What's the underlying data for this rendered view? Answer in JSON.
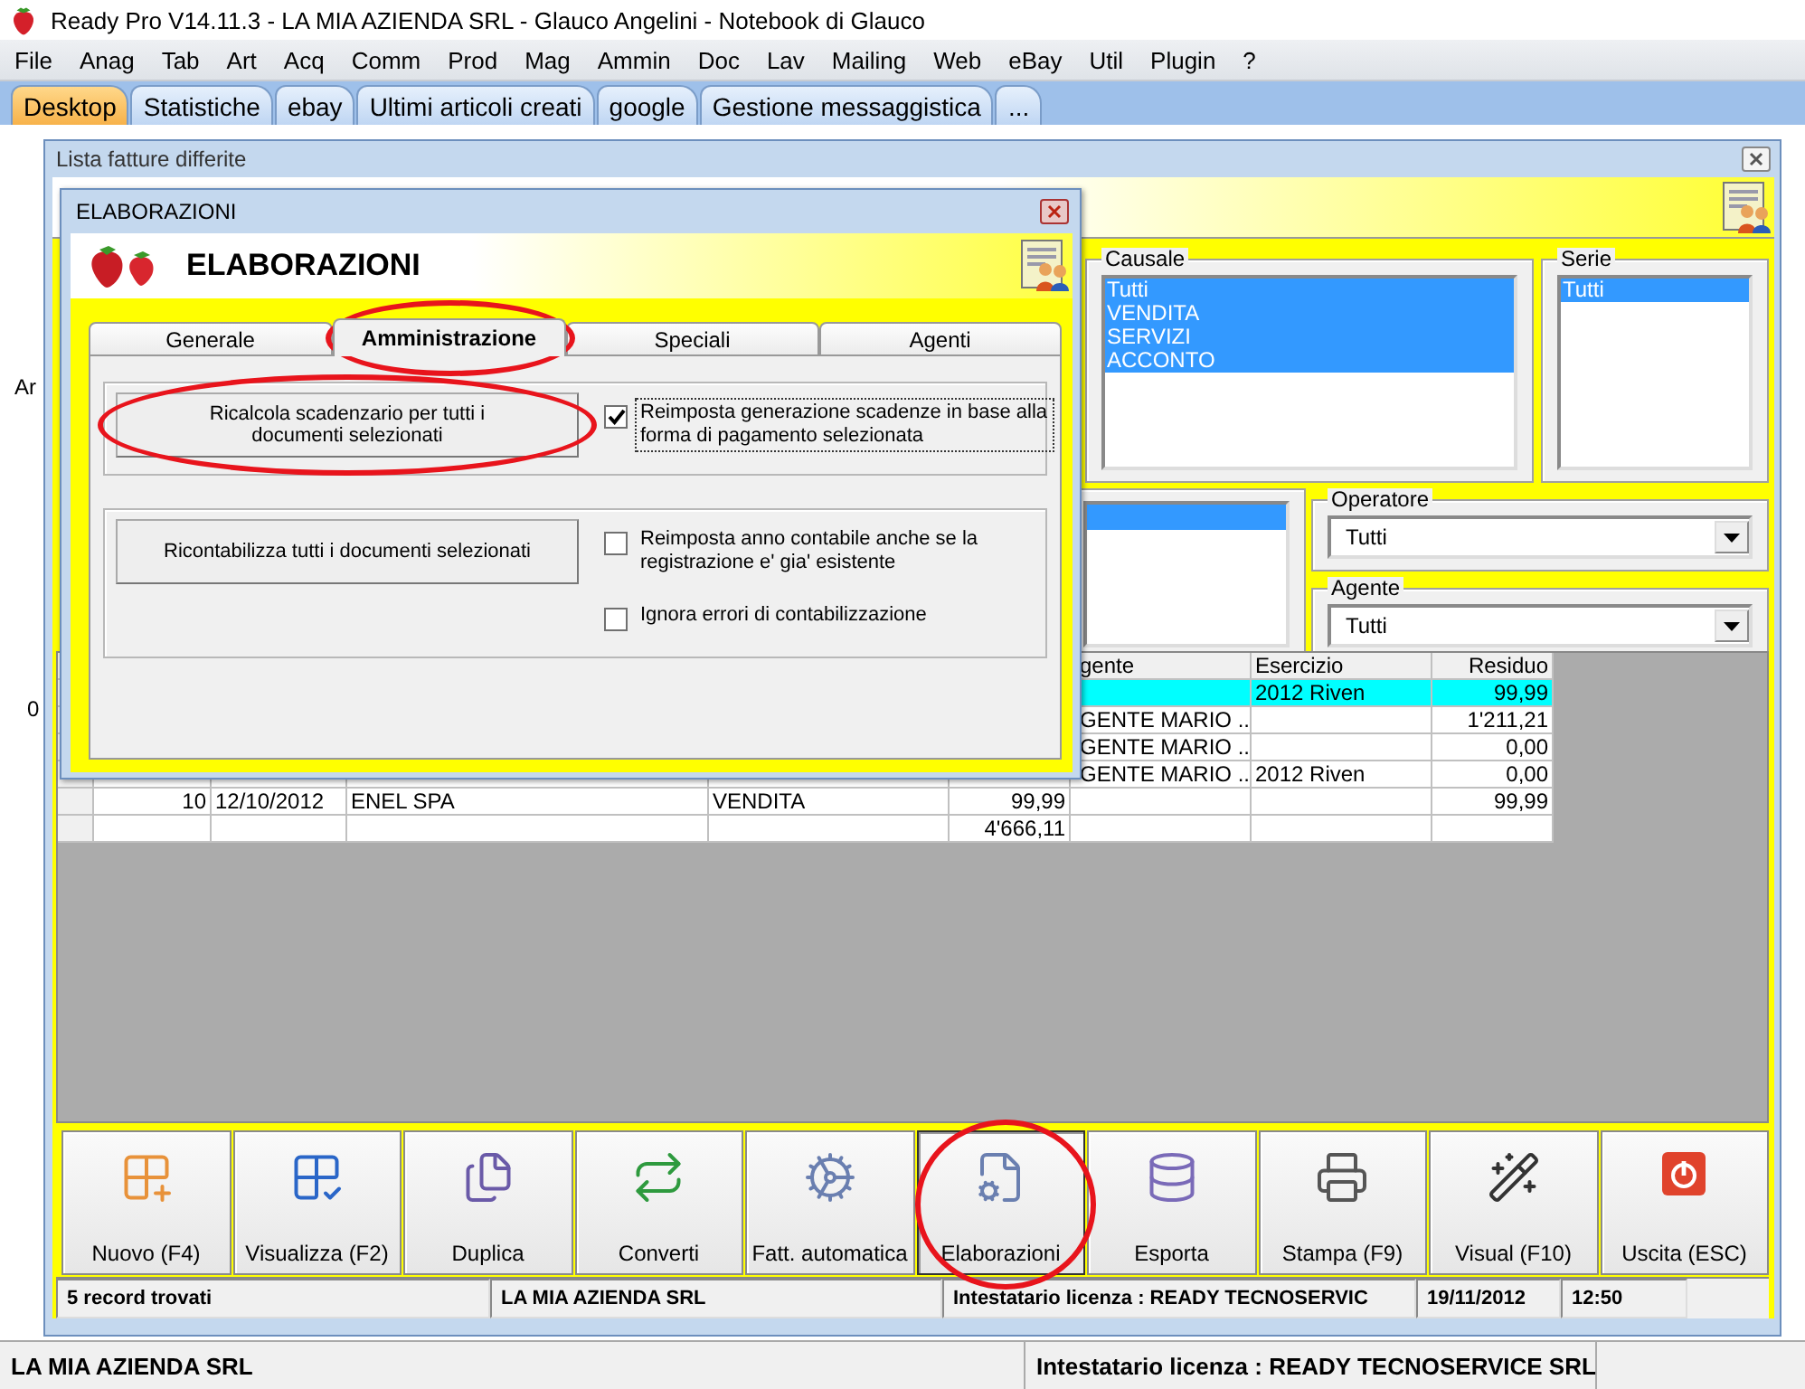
{
  "window": {
    "title": "Ready Pro V14.11.3 - LA MIA AZIENDA SRL - Glauco Angelini - Notebook di Glauco"
  },
  "menu": [
    "File",
    "Anag",
    "Tab",
    "Art",
    "Acq",
    "Comm",
    "Prod",
    "Mag",
    "Ammin",
    "Doc",
    "Lav",
    "Mailing",
    "Web",
    "eBay",
    "Util",
    "Plugin",
    "?"
  ],
  "tabs": [
    {
      "label": "Desktop",
      "selected": true
    },
    {
      "label": "Statistiche",
      "selected": false
    },
    {
      "label": "ebay",
      "selected": false
    },
    {
      "label": "Ultimi articoli creati",
      "selected": false
    },
    {
      "label": "google",
      "selected": false
    },
    {
      "label": "Gestione messaggistica",
      "selected": false
    },
    {
      "label": "...",
      "selected": false
    }
  ],
  "desktop_fragments": [
    "Ar",
    "0"
  ],
  "list_window": {
    "title": "Lista fatture differite",
    "causale": {
      "label": "Causale",
      "items": [
        {
          "label": "Tutti",
          "selected": true
        },
        {
          "label": "VENDITA",
          "selected": true
        },
        {
          "label": "SERVIZI",
          "selected": true
        },
        {
          "label": "ACCONTO",
          "selected": true
        }
      ]
    },
    "serie": {
      "label": "Serie",
      "items": [
        {
          "label": "Tutti",
          "selected": true
        }
      ]
    },
    "left_list": {
      "items": [
        {
          "selected": true
        }
      ]
    },
    "operatore": {
      "label": "Operatore",
      "value": "Tutti"
    },
    "agente": {
      "label": "Agente",
      "value": "Tutti"
    },
    "table": {
      "headers": [
        "gente",
        "Esercizio",
        "Residuo"
      ],
      "rows": [
        {
          "selected": true,
          "esercizio": "2012 Riven",
          "residuo": "99,99"
        },
        {
          "selected": false,
          "column_7": "GENTE MARIO ...",
          "residuo": "1'211,21"
        },
        {
          "selected": false,
          "column_7": "GENTE MARIO ...",
          "residuo": "0,00"
        },
        {
          "selected": false,
          "column_7": "GENTE MARIO ...",
          "esercizio": "2012 Riven",
          "residuo": "0,00"
        },
        {
          "selected": false,
          "column_2": "10",
          "column_3": "12/10/2012",
          "column_4": "ENEL SPA",
          "column_5": "VENDITA",
          "column_6": "99,99",
          "residuo": "99,99"
        },
        {
          "selected": false,
          "column_6": "4'666,11"
        }
      ]
    },
    "toolbar": [
      {
        "label": "Nuovo (F4)",
        "highlighted": false
      },
      {
        "label": "Visualizza (F2)",
        "highlighted": false
      },
      {
        "label": "Duplica",
        "highlighted": false
      },
      {
        "label": "Converti",
        "highlighted": false
      },
      {
        "label": "Fatt. automatica",
        "highlighted": false
      },
      {
        "label": "Elaborazioni",
        "highlighted": true
      },
      {
        "label": "Esporta",
        "highlighted": false
      },
      {
        "label": "Stampa (F9)",
        "highlighted": false
      },
      {
        "label": "Visual (F10)",
        "highlighted": false
      },
      {
        "label": "Uscita (ESC)",
        "highlighted": false
      }
    ],
    "status_bar": [
      "5 record trovati",
      "LA MIA AZIENDA SRL",
      "Intestatario licenza : READY TECNOSERVIC",
      "19/11/2012",
      "12:50"
    ]
  },
  "dialog": {
    "title": "ELABORAZIONI",
    "heading": "ELABORAZIONI",
    "tabs": [
      {
        "label": "Generale",
        "selected": false,
        "highlighted": false
      },
      {
        "label": "Amministrazione",
        "selected": true,
        "highlighted": true
      },
      {
        "label": "Speciali",
        "selected": false,
        "highlighted": false
      },
      {
        "label": "Agenti",
        "selected": false,
        "highlighted": false
      }
    ],
    "groups": [
      {
        "button": {
          "label": "Ricalcola scadenzario per tutti i documenti selezionati",
          "highlighted": true
        },
        "options": [
          {
            "label": "Reimposta generazione scadenze in base alla forma di pagamento selezionata",
            "checked": true,
            "focused": true
          }
        ]
      },
      {
        "button": {
          "label": "Ricontabilizza tutti i documenti selezionati",
          "highlighted": false
        },
        "options": [
          {
            "label": "Reimposta anno contabile anche se la registrazione e' gia' esistente",
            "checked": false,
            "focused": false
          },
          {
            "label": "Ignora errori di contabilizzazione",
            "checked": false,
            "focused": false
          }
        ]
      }
    ]
  },
  "status_bar": [
    "LA MIA AZIENDA SRL",
    "Intestatario licenza : READY TECNOSERVICE SRL"
  ]
}
